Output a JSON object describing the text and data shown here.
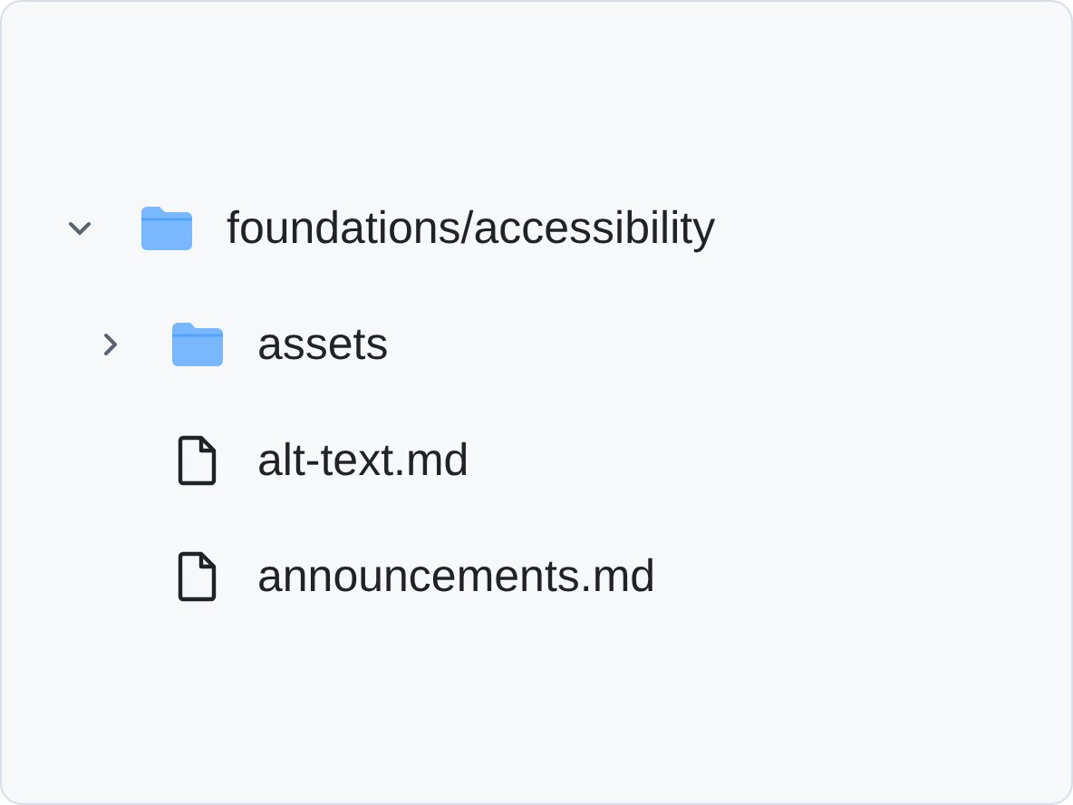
{
  "tree": [
    {
      "kind": "folder",
      "name": "foundations/accessibility",
      "expanded": true,
      "children": [
        {
          "kind": "folder",
          "name": "assets",
          "expanded": false
        },
        {
          "kind": "file",
          "name": "alt-text.md"
        },
        {
          "kind": "file",
          "name": "announcements.md"
        }
      ]
    }
  ]
}
